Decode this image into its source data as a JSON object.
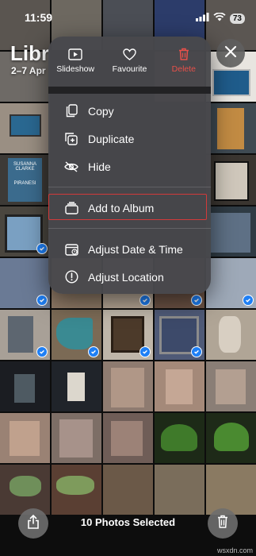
{
  "status_bar": {
    "time": "11:59",
    "battery": "73"
  },
  "header": {
    "title": "Libr",
    "date_range": "2–7 Apr"
  },
  "context_menu": {
    "top_actions": [
      {
        "label": "Slideshow",
        "icon": "play-icon"
      },
      {
        "label": "Favourite",
        "icon": "heart-icon"
      },
      {
        "label": "Delete",
        "icon": "trash-icon",
        "color": "#e8504a"
      }
    ],
    "items": [
      {
        "label": "Copy",
        "icon": "copy-icon"
      },
      {
        "label": "Duplicate",
        "icon": "duplicate-icon"
      },
      {
        "label": "Hide",
        "icon": "hide-icon"
      },
      {
        "label": "Add to Album",
        "icon": "album-icon",
        "highlighted": true
      },
      {
        "label": "Adjust Date & Time",
        "icon": "calendar-icon"
      },
      {
        "label": "Adjust Location",
        "icon": "location-icon"
      }
    ]
  },
  "bottom_bar": {
    "selection_text": "10 Photos Selected"
  },
  "book_cover": {
    "author": "SUSANNA CLARKE",
    "title": "PIRANESI"
  },
  "watermark": "wsxdn.com",
  "colors": {
    "accent": "#1e7ff5",
    "delete": "#e8504a",
    "highlight_border": "#d23a3a"
  }
}
